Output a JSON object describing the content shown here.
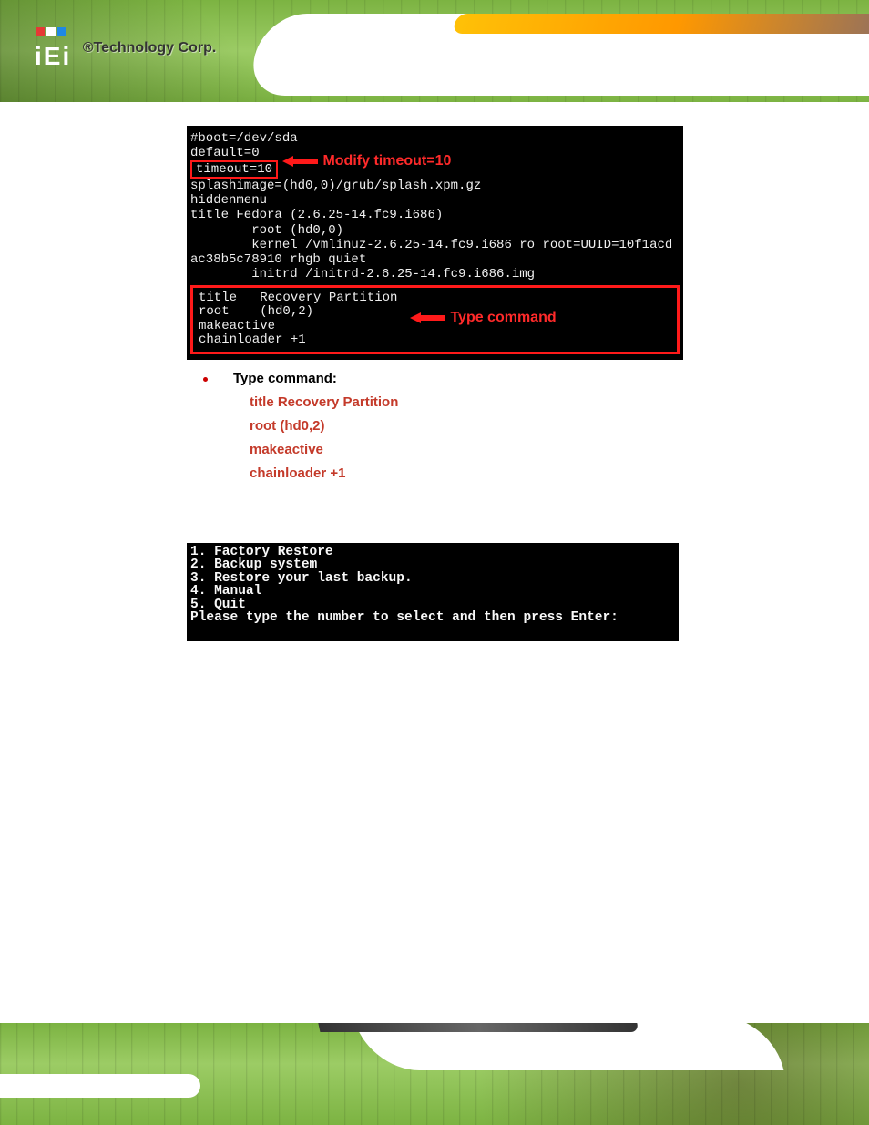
{
  "header": {
    "brand": "®Technology Corp.",
    "logo_alt": "iEi"
  },
  "terminal1": {
    "line1": "#boot=/dev/sda",
    "line2": "default=0",
    "timeout_box": "timeout=10",
    "arrow1_label": "Modify timeout=10",
    "line4": "splashimage=(hd0,0)/grub/splash.xpm.gz",
    "line5": "hiddenmenu",
    "line6": "title Fedora (2.6.25-14.fc9.i686)",
    "line7": "        root (hd0,0)",
    "line8": "        kernel /vmlinuz-2.6.25-14.fc9.i686 ro root=UUID=10f1acd",
    "line9": "ac38b5c78910 rhgb quiet",
    "line10": "        initrd /initrd-2.6.25-14.fc9.i686.img",
    "frame_l1": "title   Recovery Partition",
    "frame_l2": "root    (hd0,2)",
    "frame_l3": "makeactive",
    "frame_l4": "chainloader +1",
    "arrow2_label": "Type command"
  },
  "bullet": {
    "label": "Type command:",
    "cmd1": "title Recovery Partition",
    "cmd2": "root (hd0,2)",
    "cmd3": "makeactive",
    "cmd4": "chainloader +1"
  },
  "terminal2": {
    "l1": "1. Factory Restore",
    "l2": "2. Backup system",
    "l3": "3. Restore your last backup.",
    "l4": "4. Manual",
    "l5": "5. Quit",
    "prompt": "Please type the number to select and then press Enter:"
  }
}
